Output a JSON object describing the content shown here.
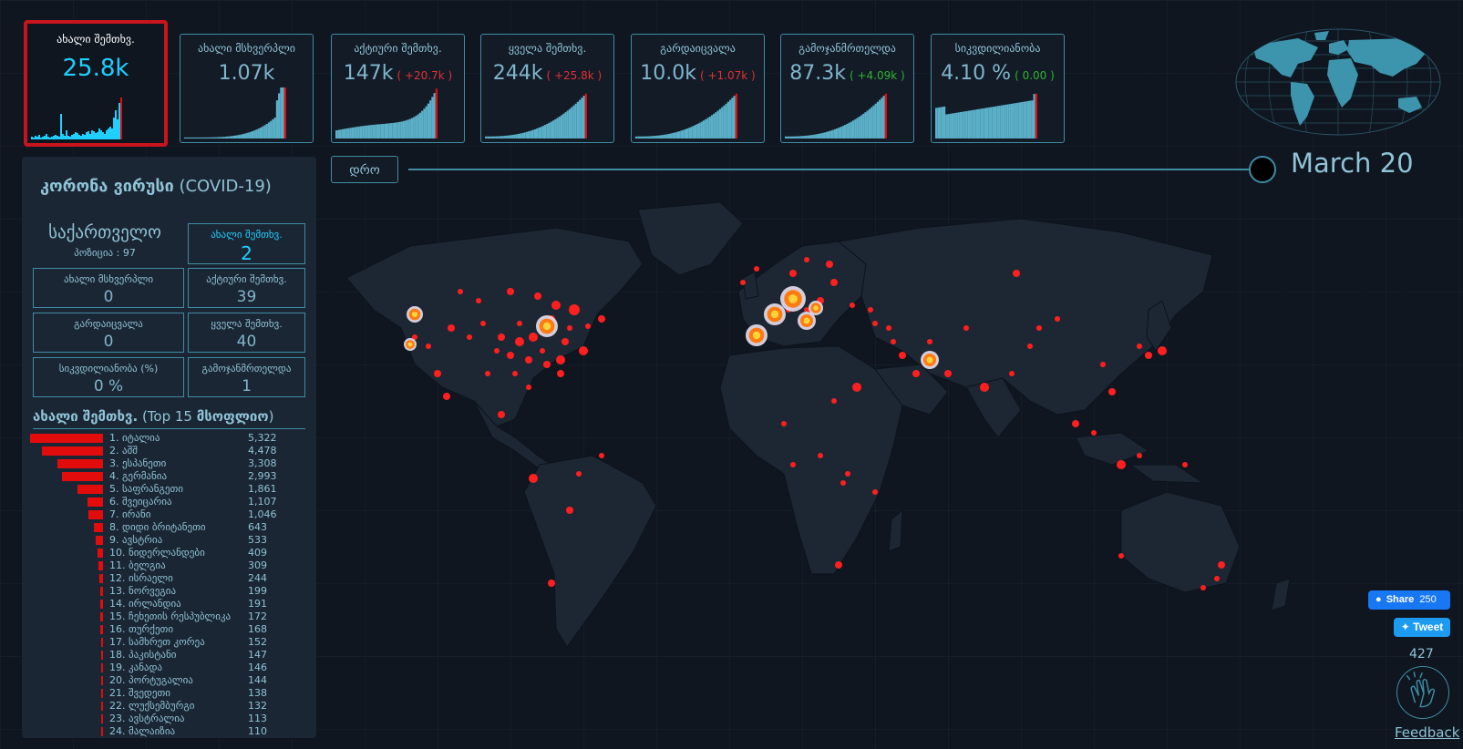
{
  "stats": [
    {
      "label": "ახალი შემთხვ.",
      "value": "25.8k",
      "change": "",
      "change_color": "",
      "active": true
    },
    {
      "label": "ახალი მსხვერპლი",
      "value": "1.07k",
      "change": "",
      "change_color": ""
    },
    {
      "label": "აქტიური შემთხვ.",
      "value": "147k",
      "change": "( +20.7k )",
      "change_color": "#e23131"
    },
    {
      "label": "ყველა შემთხვ.",
      "value": "244k",
      "change": "( +25.8k )",
      "change_color": "#e23131"
    },
    {
      "label": "გარდაიცვალა",
      "value": "10.0k",
      "change": "( +1.07k )",
      "change_color": "#e23131"
    },
    {
      "label": "გამოჯანმრთელდა",
      "value": "87.3k",
      "change": "( +4.09k )",
      "change_color": "#30b530"
    },
    {
      "label": "სიკვდილიანობა",
      "value": "4.10 %",
      "change": "( 0.00 )",
      "change_color": "#30b530"
    }
  ],
  "timeline": {
    "button_label": "დრო",
    "date": "March 20"
  },
  "panel": {
    "title_bold": "კორონა ვირუსი",
    "title_rest": " (COVID-19)",
    "country": "საქართველო",
    "position": "პოზიცია : 97",
    "new_cases": {
      "label": "ახალი შემთხვ.",
      "value": "2"
    },
    "new_deaths": {
      "label": "ახალი მსხვერპლი",
      "value": "0"
    },
    "active": {
      "label": "აქტიური შემთხვ.",
      "value": "39"
    },
    "deaths": {
      "label": "გარდაიცვალა",
      "value": "0"
    },
    "total": {
      "label": "ყველა შემთხვ.",
      "value": "40"
    },
    "mortality": {
      "label": "სიკვდილიანობა (%)",
      "value": "0 %"
    },
    "recovered": {
      "label": "გამოჯანმრთელდა",
      "value": "1"
    },
    "top_title_bold": "ახალი შემთხვ.",
    "top_title_mid": " (Top 15 ",
    "top_title_bold2": "მსოფლიო",
    "top_title_end": ")"
  },
  "top_list": [
    {
      "name": "1. იტალია",
      "value": "5,322",
      "n": 5322
    },
    {
      "name": "2. აშშ",
      "value": "4,478",
      "n": 4478
    },
    {
      "name": "3. ესპანეთი",
      "value": "3,308",
      "n": 3308
    },
    {
      "name": "4. გერმანია",
      "value": "2,993",
      "n": 2993
    },
    {
      "name": "5. საფრანგეთი",
      "value": "1,861",
      "n": 1861
    },
    {
      "name": "6. შვეიცარია",
      "value": "1,107",
      "n": 1107
    },
    {
      "name": "7. ირანი",
      "value": "1,046",
      "n": 1046
    },
    {
      "name": "8. დიდი ბრიტანეთი",
      "value": "643",
      "n": 643
    },
    {
      "name": "9. ავსტრია",
      "value": "533",
      "n": 533
    },
    {
      "name": "10. ნიდერლანდები",
      "value": "409",
      "n": 409
    },
    {
      "name": "11. ბელგია",
      "value": "309",
      "n": 309
    },
    {
      "name": "12. ისრაელი",
      "value": "244",
      "n": 244
    },
    {
      "name": "13. ნორვეგია",
      "value": "199",
      "n": 199
    },
    {
      "name": "14. ირლანდია",
      "value": "191",
      "n": 191
    },
    {
      "name": "15. ჩეხეთის რესპუბლიკა",
      "value": "172",
      "n": 172
    },
    {
      "name": "16. თურქეთი",
      "value": "168",
      "n": 168
    },
    {
      "name": "17. სამხრეთ კორეა",
      "value": "152",
      "n": 152
    },
    {
      "name": "18. პაკისტანი",
      "value": "147",
      "n": 147
    },
    {
      "name": "19. კანადა",
      "value": "146",
      "n": 146
    },
    {
      "name": "20. პორტუგალია",
      "value": "144",
      "n": 144
    },
    {
      "name": "21. შვედეთი",
      "value": "138",
      "n": 138
    },
    {
      "name": "22. ლუქსემბურგი",
      "value": "132",
      "n": 132
    },
    {
      "name": "23. ავსტრალია",
      "value": "113",
      "n": 113
    },
    {
      "name": "24. მალაიზია",
      "value": "110",
      "n": 110
    }
  ],
  "social": {
    "share_label": "Share",
    "share_count": "250",
    "tweet_label": "Tweet",
    "clap_count": "427",
    "feedback": "Feedback"
  },
  "colors": {
    "accent": "#1fd0ff",
    "border": "#3f8ca3",
    "text": "#8fc3d6",
    "alert": "#e30c0c",
    "bg": "#0f1620"
  }
}
